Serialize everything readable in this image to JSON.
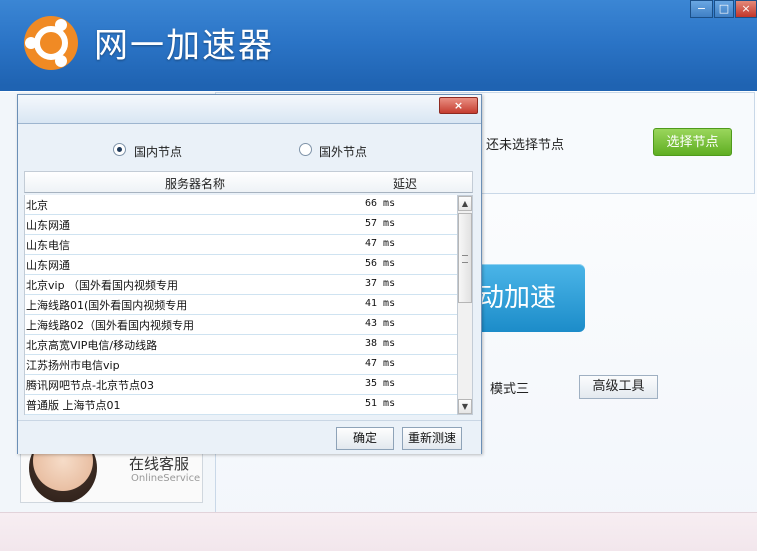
{
  "app": {
    "title": "网一加速器",
    "window_controls": {
      "minimize": "−",
      "maximize": "□",
      "close": "×"
    }
  },
  "node_panel": {
    "status_text": "还未选择节点",
    "select_button": "选择节点"
  },
  "accelerate_button": "动加速",
  "modes": {
    "mode3": "模式三"
  },
  "advanced_tools_button": "高级工具",
  "online_service": {
    "cn": "在线客服",
    "en": "OnlineService"
  },
  "dialog": {
    "close": "×",
    "radio_domestic": "国内节点",
    "radio_foreign": "国外节点",
    "selected_radio": "国内节点",
    "columns": {
      "name": "服务器名称",
      "delay": "延迟"
    },
    "rows": [
      {
        "name": "北京",
        "delay": "66 ms"
      },
      {
        "name": "山东网通",
        "delay": "57 ms"
      },
      {
        "name": "山东电信",
        "delay": "47 ms"
      },
      {
        "name": "山东网通",
        "delay": "56 ms"
      },
      {
        "name": "北京vip  （国外看国内视频专用",
        "delay": "37 ms"
      },
      {
        "name": "上海线路01(国外看国内视频专用",
        "delay": "41 ms"
      },
      {
        "name": "上海线路02（国外看国内视频专用",
        "delay": "43 ms"
      },
      {
        "name": "北京高宽VIP电信/移动线路",
        "delay": "38 ms"
      },
      {
        "name": "江苏扬州市电信vip",
        "delay": "47 ms"
      },
      {
        "name": "腾讯网吧节点-北京节点03",
        "delay": "35 ms"
      },
      {
        "name": "普通版 上海节点01",
        "delay": "51 ms"
      }
    ],
    "confirm_button": "确定",
    "retest_button": "重新测速"
  },
  "colors": {
    "title_blue": "#2b74c6",
    "green_button": "#6fbf2e",
    "accel_blue": "#2a9ad6"
  }
}
